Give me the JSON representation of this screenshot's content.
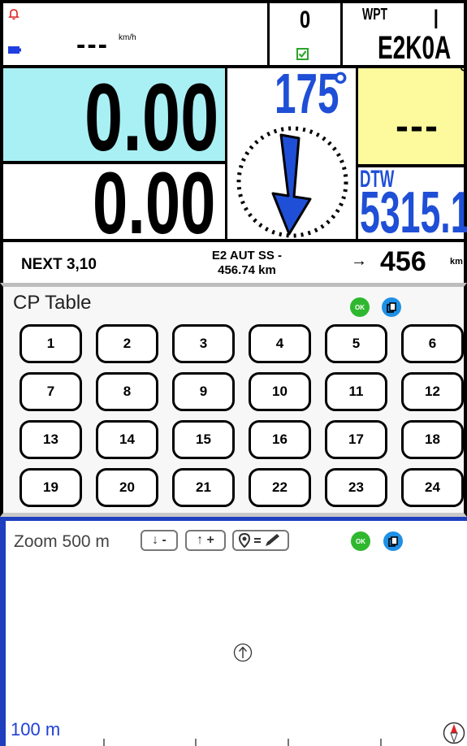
{
  "top": {
    "speed_value": "---",
    "speed_unit": "km/h",
    "counter_value": "0",
    "wpt_label": "WPT",
    "wpt_cursor": "I",
    "wpt_name": "E2K0A"
  },
  "dashboard": {
    "distance_primary": "0.00",
    "distance_secondary": "0.00",
    "heading": "175",
    "heading_unit": "°",
    "yellow_value": "---",
    "yellow_unit": "°",
    "dtw_label": "DTW",
    "dtw_value": "5315.1"
  },
  "next": {
    "label": "NEXT 3,10",
    "stage_line1": "E2 AUT SS -",
    "stage_line2": "456.74 km",
    "arrow": "→",
    "distance": "456",
    "unit": "km"
  },
  "cp_table": {
    "title": "CP Table",
    "ok_label": "OK",
    "buttons": [
      "1",
      "2",
      "3",
      "4",
      "5",
      "6",
      "7",
      "8",
      "9",
      "10",
      "11",
      "12",
      "13",
      "14",
      "15",
      "16",
      "17",
      "18",
      "19",
      "20",
      "21",
      "22",
      "23",
      "24"
    ]
  },
  "map": {
    "zoom_label": "Zoom 500 m",
    "zoom_out_label": "↓ -",
    "zoom_in_label": "↑ +",
    "ok_label": "OK",
    "scale_label": "100 m"
  },
  "colors": {
    "cyan_panel": "#a9f0f4",
    "yellow_panel": "#fdfa9e",
    "accent_blue": "#1f4fd6",
    "ok_green": "#2fb82f",
    "copy_blue": "#1e90e6"
  },
  "icons": {
    "alarm": "bell-icon",
    "battery": "battery-icon",
    "check": "checkbox-icon",
    "copy": "copy-icon",
    "pin_edit": "pin-edit-icon",
    "north_up": "north-arrow-icon",
    "compass": "compass-icon"
  }
}
